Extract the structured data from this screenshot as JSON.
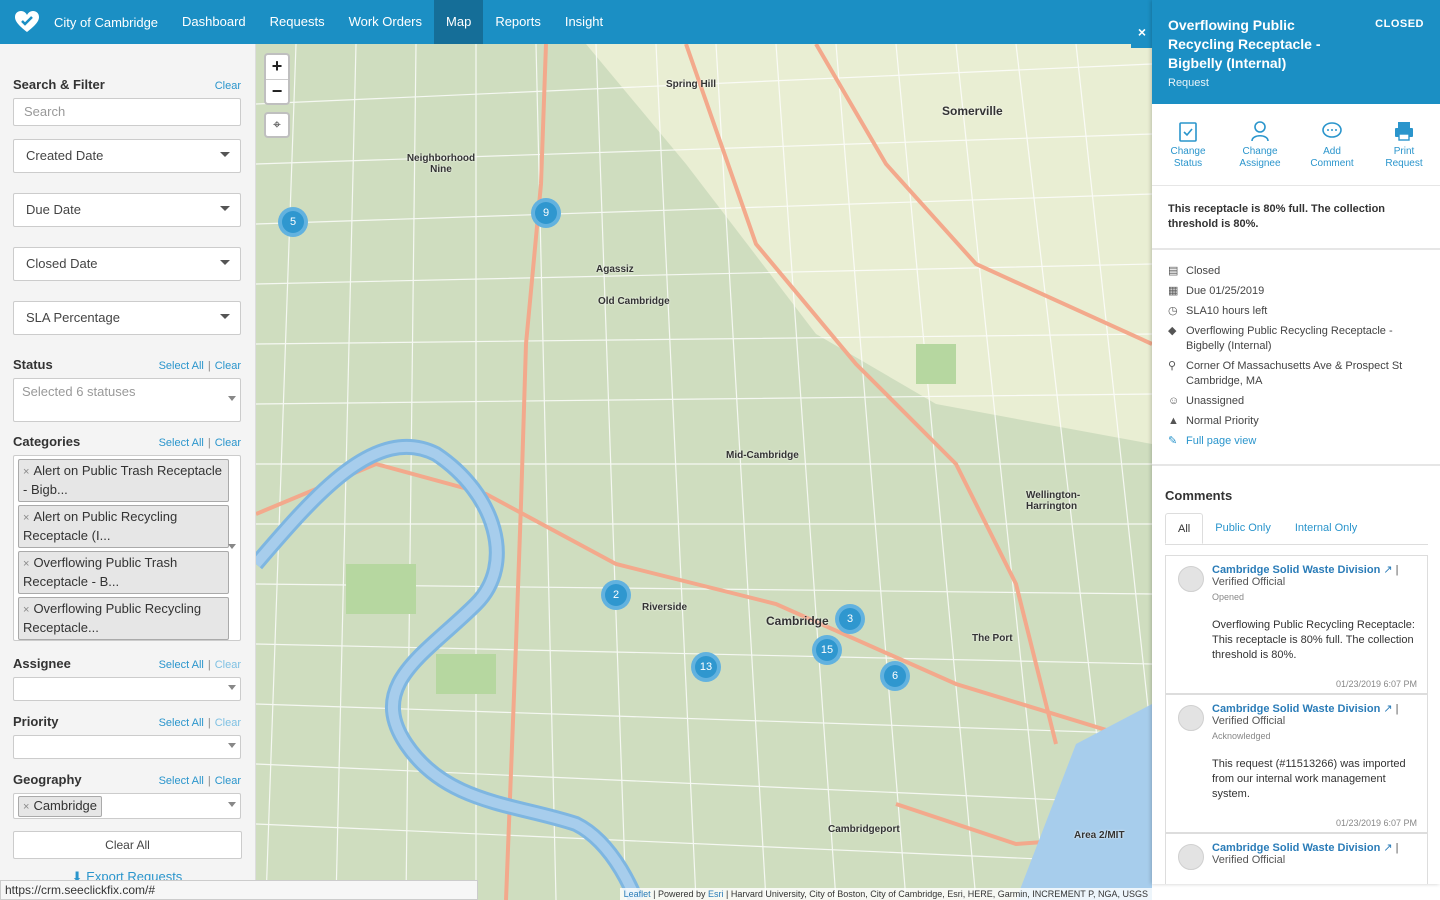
{
  "nav": {
    "org": "City of Cambridge",
    "links": [
      "Dashboard",
      "Requests",
      "Work Orders",
      "Map",
      "Reports",
      "Insight"
    ],
    "active": "Map"
  },
  "sidebar": {
    "search_filter": {
      "title": "Search & Filter",
      "clear": "Clear",
      "search_placeholder": "Search"
    },
    "date_filters": [
      "Created Date",
      "Due Date",
      "Closed Date",
      "SLA Percentage"
    ],
    "status": {
      "title": "Status",
      "select_all": "Select All",
      "clear": "Clear",
      "value": "Selected 6 statuses"
    },
    "categories": {
      "title": "Categories",
      "select_all": "Select All",
      "clear": "Clear",
      "chips": [
        "Alert on Public Trash Receptacle - Bigb...",
        "Alert on Public Recycling Receptacle (I...",
        "Overflowing Public Trash Receptacle - B...",
        "Overflowing Public Recycling Receptacle..."
      ]
    },
    "assignee": {
      "title": "Assignee",
      "select_all": "Select All",
      "clear": "Clear"
    },
    "priority": {
      "title": "Priority",
      "select_all": "Select All",
      "clear": "Clear"
    },
    "geography": {
      "title": "Geography",
      "select_all": "Select All",
      "clear": "Clear",
      "chip": "Cambridge"
    },
    "clear_all": "Clear All",
    "export": "Export Requests"
  },
  "map": {
    "zoom_in": "+",
    "zoom_out": "−",
    "clusters": [
      "5",
      "9",
      "2",
      "13",
      "15",
      "3",
      "6"
    ],
    "labels": [
      "Spring Hill",
      "Somerville",
      "Neighborhood Nine",
      "Agassiz",
      "Old Cambridge",
      "Mid-Cambridge",
      "Wellington-Harrington",
      "Riverside",
      "Cambridge",
      "The Port",
      "Cambridgeport",
      "Area 2/MIT"
    ],
    "attribution_leaflet": "Leaflet",
    "attribution_sep": " | Powered by ",
    "attribution_esri": "Esri",
    "attribution_rest": " | Harvard University, City of Boston, City of Cambridge, Esri, HERE, Garmin, INCREMENT P, NGA, USGS"
  },
  "panel": {
    "close": "×",
    "title": "Overflowing Public Recycling Receptacle - Bigbelly (Internal)",
    "subtitle": "Request",
    "status": "CLOSED",
    "actions": [
      {
        "label1": "Change",
        "label2": "Status"
      },
      {
        "label1": "Change",
        "label2": "Assignee"
      },
      {
        "label1": "Add",
        "label2": "Comment"
      },
      {
        "label1": "Print",
        "label2": "Request"
      }
    ],
    "description": "This receptacle is 80% full. The collection threshold is 80%.",
    "meta": {
      "state": "Closed",
      "due": "Due  01/25/2019",
      "sla": "SLA10 hours left",
      "category": "Overflowing Public Recycling Receptacle - Bigbelly (Internal)",
      "address": "Corner Of Massachusetts Ave & Prospect St Cambridge, MA",
      "assignee": "Unassigned",
      "priority": "Normal Priority",
      "full_page": "Full page view"
    },
    "comments": {
      "title": "Comments",
      "tabs": [
        "All",
        "Public Only",
        "Internal Only"
      ],
      "items": [
        {
          "author": "Cambridge Solid Waste Division",
          "role": "| Verified Official",
          "kind": "Opened",
          "body": "Overflowing Public Recycling Receptacle: This receptacle is 80% full. The collection threshold is 80%.",
          "when": "01/23/2019 6:07 PM"
        },
        {
          "author": "Cambridge Solid Waste Division",
          "role": "| Verified Official",
          "kind": "Acknowledged",
          "body": "This request (#11513266) was imported from our internal work management system.",
          "when": "01/23/2019 6:07 PM"
        },
        {
          "author": "Cambridge Solid Waste Division",
          "role": "| Verified Official",
          "kind": "",
          "body": "",
          "when": ""
        }
      ]
    }
  },
  "statusbar": {
    "url": "https://crm.seeclickfix.com/#"
  },
  "colors": {
    "brand": "#1b8fc4",
    "link": "#2a95cc",
    "cluster": "#2f97cf"
  }
}
